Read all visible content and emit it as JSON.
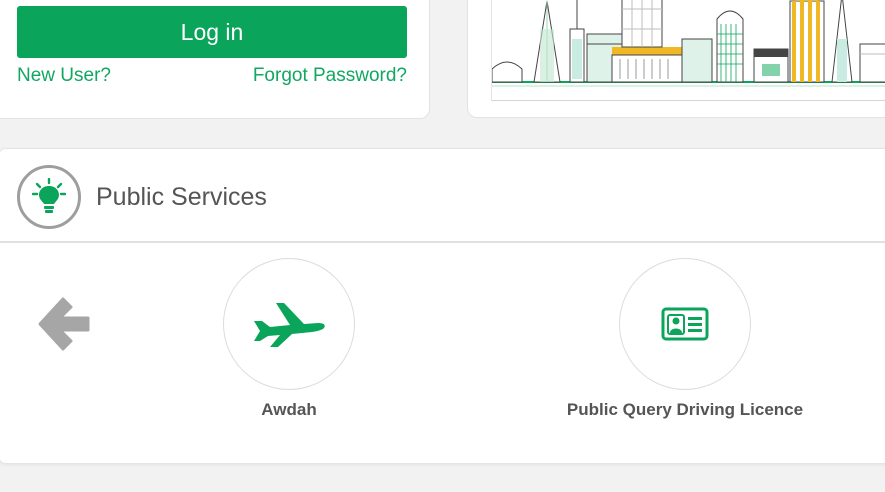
{
  "login": {
    "button_label": "Log in",
    "new_user": "New User?",
    "forgot_password": "Forgot Password?"
  },
  "public_services": {
    "title": "Public Services",
    "items": [
      {
        "label": "Awdah",
        "icon": "airplane-icon"
      },
      {
        "label": "Public Query Driving Licence",
        "icon": "id-card-icon"
      }
    ],
    "nav_icon": "arrow-left-icon"
  },
  "colors": {
    "brand_green": "#0aa55a",
    "link_green": "#12a760",
    "text_gray": "#555555",
    "arrow_gray": "#a6a6a6"
  }
}
